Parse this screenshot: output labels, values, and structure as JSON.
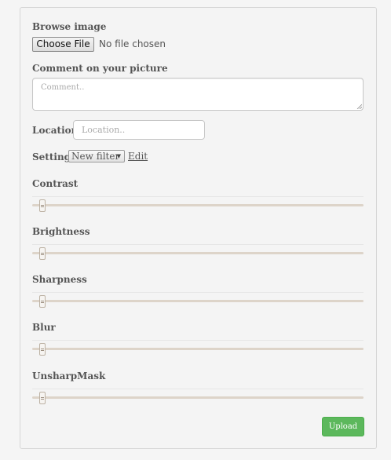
{
  "form": {
    "browse_label": "Browse image",
    "file_button_label": "Choose File",
    "file_status": "No file chosen",
    "comment_label": "Comment on your picture",
    "comment_placeholder": "Comment..",
    "comment_value": "",
    "location_label": "Location",
    "location_placeholder": "Location..",
    "location_value": "",
    "settings_label": "Settings",
    "filter_selected": "New filter",
    "edit_label": "Edit",
    "sliders": [
      {
        "label": "Contrast",
        "value": 0.03
      },
      {
        "label": "Brightness",
        "value": 0.03
      },
      {
        "label": "Sharpness",
        "value": 0.03
      },
      {
        "label": "Blur",
        "value": 0.03
      },
      {
        "label": "UnsharpMask",
        "value": 0.03
      }
    ],
    "upload_label": "Upload"
  },
  "colors": {
    "upload_button": "#5cb85c",
    "slider_track": "#ddd4c9"
  },
  "icons": {
    "select_caret": "caret-down-icon",
    "textarea_grip": "resize-grip-icon",
    "slider_handle": "slider-handle-icon"
  }
}
